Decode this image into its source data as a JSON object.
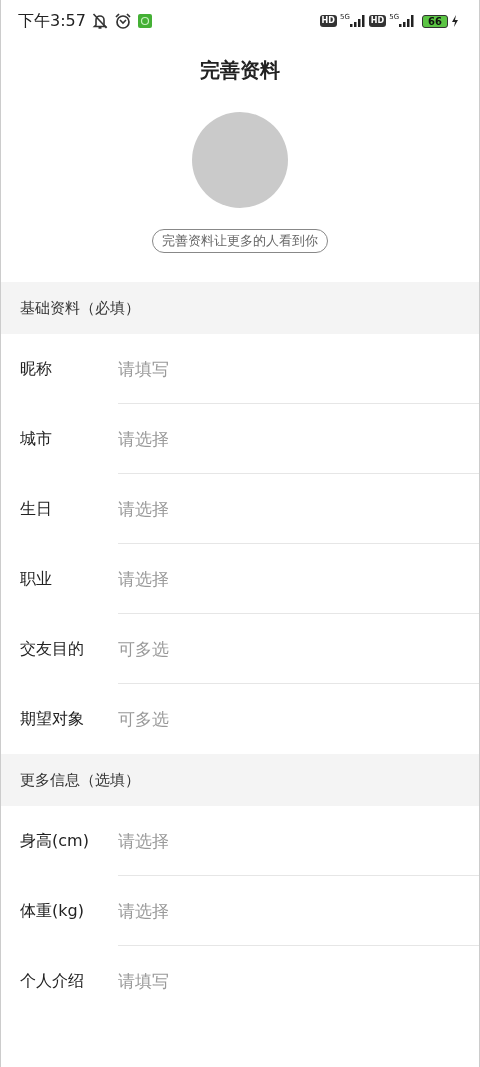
{
  "status_bar": {
    "time": "下午3:57",
    "sim_labels": [
      "HD",
      "HD"
    ],
    "network_labels": [
      "5G",
      "5G"
    ],
    "battery": "66"
  },
  "header": {
    "title": "完善资料"
  },
  "profile": {
    "hint": "完善资料让更多的人看到你"
  },
  "sections": [
    {
      "title": "基础资料（必填）",
      "fields": [
        {
          "label": "昵称",
          "placeholder": "请填写"
        },
        {
          "label": "城市",
          "placeholder": "请选择"
        },
        {
          "label": "生日",
          "placeholder": "请选择"
        },
        {
          "label": "职业",
          "placeholder": "请选择"
        },
        {
          "label": "交友目的",
          "placeholder": "可多选"
        },
        {
          "label": "期望对象",
          "placeholder": "可多选"
        }
      ]
    },
    {
      "title": "更多信息（选填）",
      "fields": [
        {
          "label": "身高(cm)",
          "placeholder": "请选择"
        },
        {
          "label": "体重(kg)",
          "placeholder": "请选择"
        },
        {
          "label": "个人介绍",
          "placeholder": "请填写"
        }
      ]
    }
  ]
}
